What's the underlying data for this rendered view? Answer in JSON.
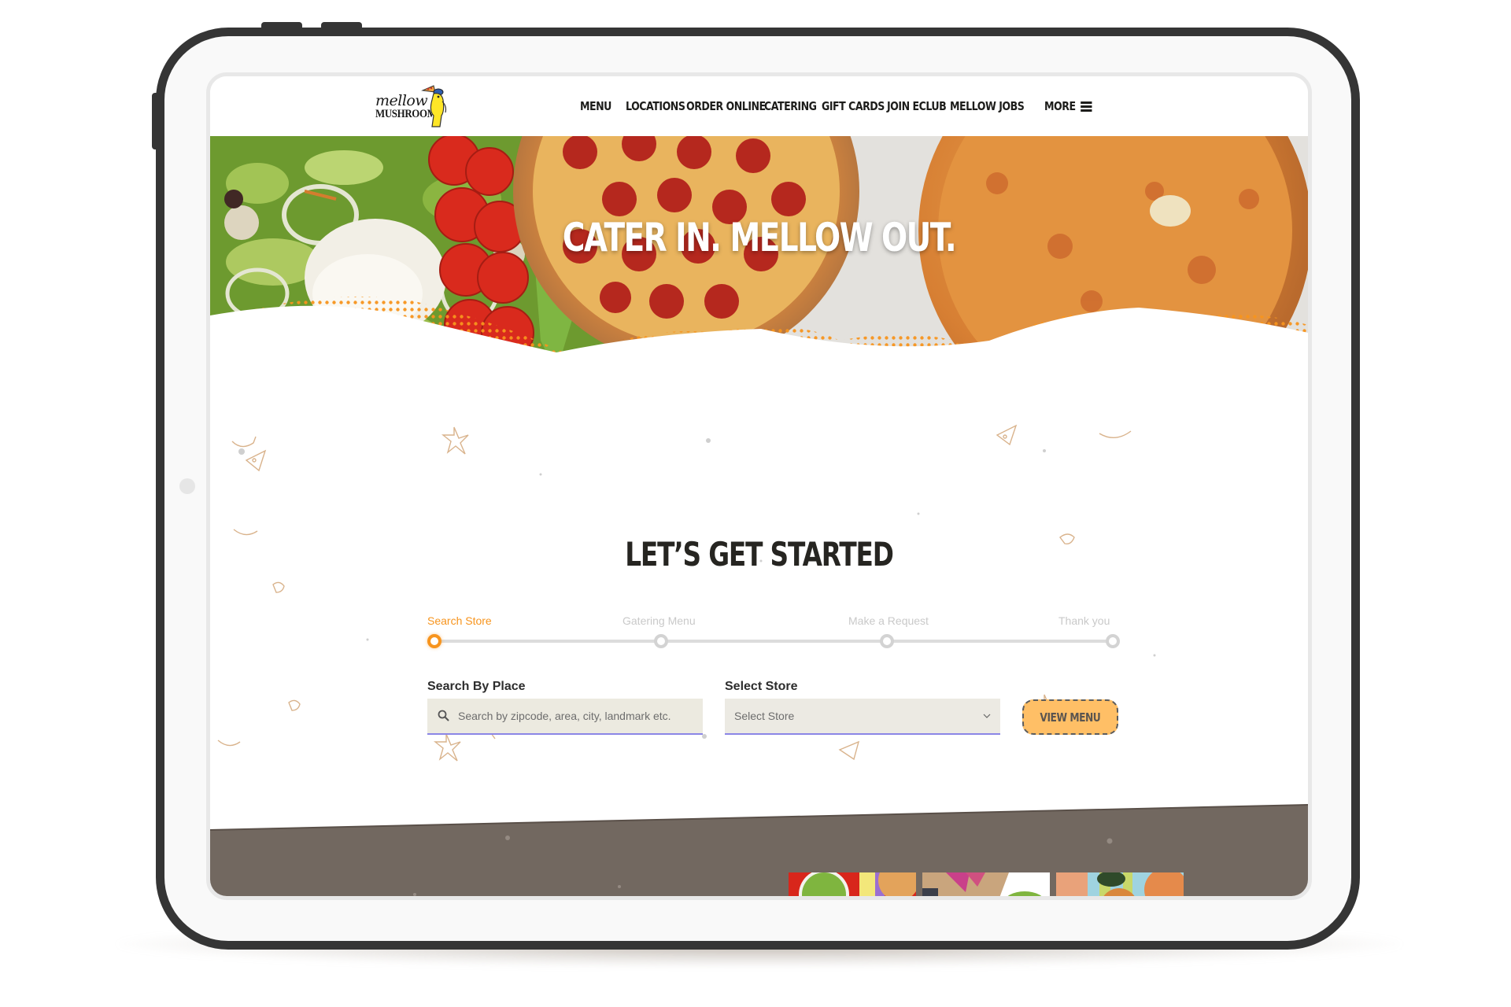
{
  "brand": {
    "name_line1": "mellow",
    "name_line2": "MUSHROOM",
    "accent_color": "#f7941d",
    "button_color": "#ffbf66",
    "footer_color": "#726860"
  },
  "nav": {
    "items": [
      {
        "label": "MENU"
      },
      {
        "label": "LOCATIONS"
      },
      {
        "label": "ORDER ONLINE"
      },
      {
        "label": "CATERING"
      },
      {
        "label": "GIFT CARDS"
      },
      {
        "label": "JOIN ECLUB"
      },
      {
        "label": "MELLOW JOBS"
      }
    ],
    "more_label": "MORE",
    "more_icon": "hamburger-menu-icon"
  },
  "hero": {
    "title": "CATER IN. MELLOW OUT."
  },
  "main": {
    "heading": "LET’S GET STARTED",
    "steps": [
      {
        "label": "Search Store",
        "state": "active"
      },
      {
        "label": "Gatering Menu",
        "state": "inactive"
      },
      {
        "label": "Make a Request",
        "state": "inactive"
      },
      {
        "label": "Thank you",
        "state": "inactive"
      }
    ],
    "search": {
      "label": "Search By Place",
      "placeholder": "Search by zipcode, area, city, landmark etc.",
      "value": "",
      "icon": "search-icon"
    },
    "store": {
      "label": "Select Store",
      "selected": "Select Store",
      "icon": "chevron-down-icon"
    },
    "view_menu_label": "VIEW MENU"
  },
  "footer": {
    "thumbnails": [
      {
        "alt": "salad and pizza"
      },
      {
        "alt": "pizza box and salad"
      },
      {
        "alt": "hands with pizza"
      }
    ]
  }
}
